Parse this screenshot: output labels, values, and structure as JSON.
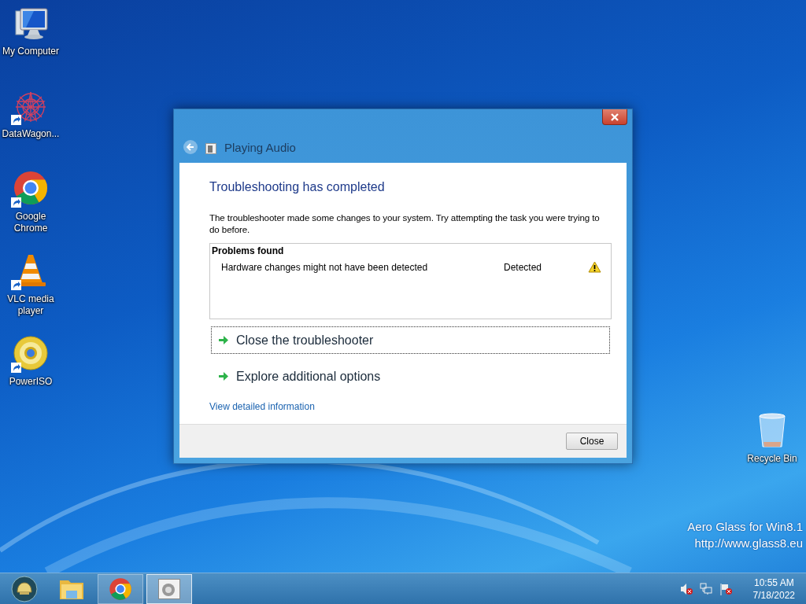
{
  "desktop_icons": [
    {
      "kind": "computer",
      "label": "My Computer",
      "shortcut": false
    },
    {
      "kind": "web",
      "label": "DataWagon...",
      "shortcut": true
    },
    {
      "kind": "chrome",
      "label": "Google Chrome",
      "shortcut": true
    },
    {
      "kind": "cone",
      "label": "VLC media player",
      "shortcut": true
    },
    {
      "kind": "disc",
      "label": "PowerISO",
      "shortcut": true
    }
  ],
  "recycle_bin": {
    "label": "Recycle Bin"
  },
  "watermark": {
    "line_1": "Aero Glass for Win8.1",
    "line_2": "http://www.glass8.eu"
  },
  "dialog": {
    "title": "Playing Audio",
    "heading": "Troubleshooting has completed",
    "message": "The troubleshooter made some changes to your system. Try attempting the task you were trying to do before.",
    "problems": {
      "header": "Problems found",
      "rows": [
        {
          "problem": "Hardware changes might not have been detected",
          "status": "Detected"
        }
      ]
    },
    "options": [
      {
        "label": "Close the troubleshooter",
        "focused": true
      },
      {
        "label": "Explore additional options",
        "focused": false
      }
    ],
    "link": "View detailed information",
    "buttons": [
      "Close"
    ]
  },
  "taskbar": {
    "items": [
      {
        "kind": "start",
        "running": false,
        "selected": false
      },
      {
        "kind": "folder",
        "running": false,
        "selected": false
      },
      {
        "kind": "chrome",
        "running": true,
        "selected": false
      },
      {
        "kind": "troubleshooter",
        "running": true,
        "selected": true
      }
    ],
    "clock": {
      "time": "10:55 AM",
      "date": "7/18/2022"
    }
  }
}
